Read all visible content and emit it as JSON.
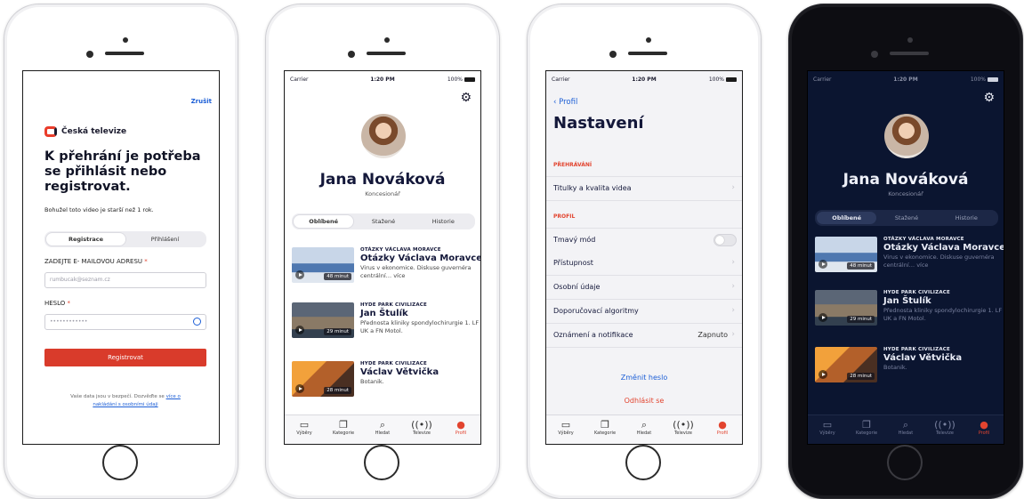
{
  "status": {
    "carrier": "Carrier",
    "time": "1:20 PM",
    "battery": "100%"
  },
  "login": {
    "cancel": "Zrušit",
    "brand": "Česká televize",
    "title": "K přehrání je potřeba se přihlásit nebo registrovat.",
    "note": "Bohužel toto video je starší než 1 rok.",
    "tabs": [
      "Registrace",
      "Přihlášení"
    ],
    "email_label": "ZADEJTE E- MAILOVOU ADRESU",
    "email_value": "rumbucak@seznam.cz",
    "password_label": "HESLO",
    "password_value": "••••••••••••",
    "submit": "Registrovat",
    "privacy_text": "Vaše data jsou v bezpečí. Dozvěďte se",
    "privacy_link": "více o nakládání s osobními údaji"
  },
  "profile": {
    "name": "Jana Nováková",
    "role": "Koncesionář",
    "tabs": [
      "Oblíbené",
      "Stažené",
      "Historie"
    ],
    "items": [
      {
        "show": "OTÁZKY VÁCLAVA MORAVCE",
        "title": "Otázky Václava Moravce",
        "desc": "Virus v ekonomice. Diskuse guvernéra centrální… více",
        "duration": "48 minut"
      },
      {
        "show": "HYDE PARK CIVILIZACE",
        "title": "Jan Štulík",
        "desc": "Přednosta kliniky spondylochirurgie 1. LF UK a FN Motol.",
        "duration": "29 minut"
      },
      {
        "show": "HYDE PARK CIVILIZACE",
        "title": "Václav Větvička",
        "desc": "Botanik.",
        "duration": "28 minut"
      }
    ]
  },
  "settings": {
    "back": "Profil",
    "title": "Nastavení",
    "section_playback": "PŘEHRÁVÁNÍ",
    "row_subtitles": "Titulky a kvalita videa",
    "section_profile": "PROFIL",
    "row_dark": "Tmavý mód",
    "row_access": "Přístupnost",
    "row_personal": "Osobní údaje",
    "row_algo": "Doporučovací algoritmy",
    "row_notif": "Oznámení a notifikace",
    "row_notif_value": "Zapnuto",
    "change_password": "Změnit heslo",
    "logout": "Odhlásit se"
  },
  "tabbar": [
    "Výběry",
    "Kategorie",
    "Hledat",
    "Televize",
    "Profil"
  ],
  "icons": [
    "tv-icon",
    "categories-icon",
    "search-icon",
    "broadcast-icon",
    "profile-icon",
    "gear-icon",
    "play-icon"
  ],
  "colors": {
    "accent_red": "#e2442f",
    "link_blue": "#1d5fd6",
    "dark_bg": "#0b1530"
  }
}
